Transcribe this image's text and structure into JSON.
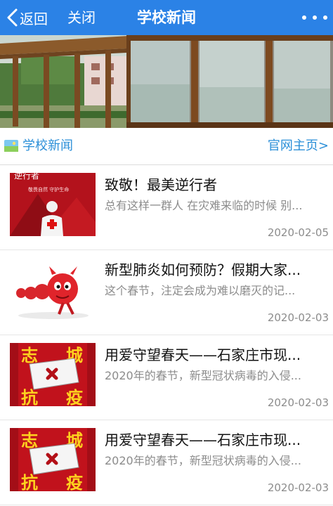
{
  "header": {
    "back_label": "返回",
    "close_label": "关闭",
    "title": "学校新闻",
    "bar_color": "#2b82e6"
  },
  "section": {
    "title": "学校新闻",
    "link": "官网主页>",
    "accent_color": "#2b8fd8"
  },
  "news": [
    {
      "title": "致敬！最美逆行者",
      "summary": "总有这样一群人 在灾难来临的时候 别...",
      "date": "2020-02-05",
      "thumb_caption": "逆行者",
      "thumb_sub": "敬畏自然 守护生命",
      "thumb_icon": "doctor-figure"
    },
    {
      "title": "新型肺炎如何预防？假期大家...",
      "summary": "这个春节，注定会成为难以磨灭的记...",
      "date": "2020-02-03",
      "thumb_icon": "virus-cartoon"
    },
    {
      "title": "用爱守望春天——石家庄市现...",
      "summary": "2020年的春节，新型冠状病毒的入侵...",
      "date": "2020-02-03",
      "thumb_chars": [
        "志",
        "城",
        "抗",
        "疫"
      ],
      "thumb_icon": "mask-poster"
    },
    {
      "title": "用爱守望春天——石家庄市现...",
      "summary": "2020年的春节，新型冠状病毒的入侵...",
      "date": "2020-02-03",
      "thumb_chars": [
        "志",
        "城",
        "抗",
        "疫"
      ],
      "thumb_icon": "mask-poster"
    }
  ]
}
